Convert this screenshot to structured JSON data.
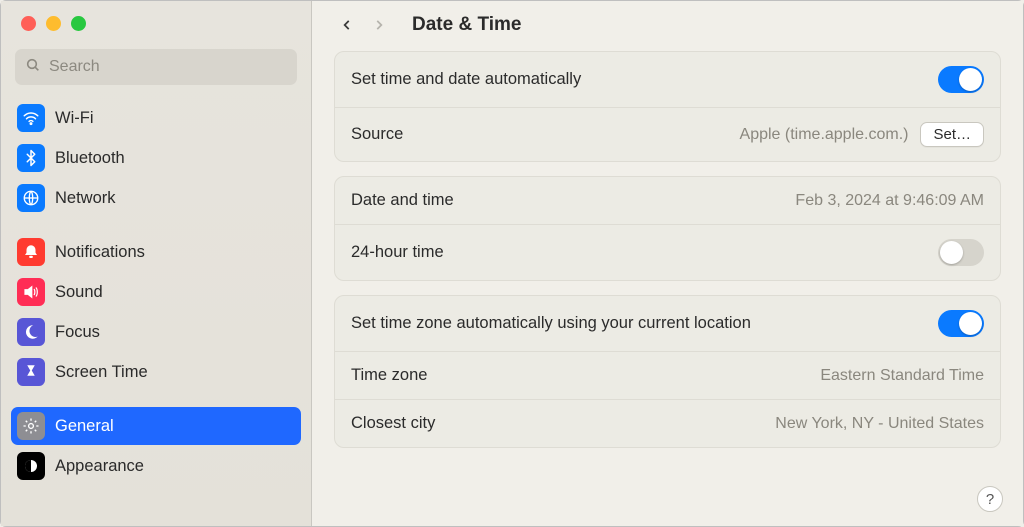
{
  "window": {
    "title": "Date & Time"
  },
  "search": {
    "placeholder": "Search"
  },
  "sidebar": {
    "items": [
      {
        "label": "Wi-Fi",
        "icon": "wifi-icon",
        "selected": false,
        "color": "bg-blue"
      },
      {
        "label": "Bluetooth",
        "icon": "bluetooth-icon",
        "selected": false,
        "color": "bg-blue"
      },
      {
        "label": "Network",
        "icon": "network-icon",
        "selected": false,
        "color": "bg-globe"
      },
      {
        "label": "Notifications",
        "icon": "notifications-icon",
        "selected": false,
        "color": "bg-red"
      },
      {
        "label": "Sound",
        "icon": "sound-icon",
        "selected": false,
        "color": "bg-pink"
      },
      {
        "label": "Focus",
        "icon": "focus-icon",
        "selected": false,
        "color": "bg-indigo"
      },
      {
        "label": "Screen Time",
        "icon": "screentime-icon",
        "selected": false,
        "color": "bg-indigo"
      },
      {
        "label": "General",
        "icon": "general-icon",
        "selected": true,
        "color": "bg-gray"
      },
      {
        "label": "Appearance",
        "icon": "appearance-icon",
        "selected": false,
        "color": "bg-black"
      }
    ]
  },
  "main": {
    "autoTime": {
      "label": "Set time and date automatically",
      "on": true
    },
    "source": {
      "label": "Source",
      "value": "Apple (time.apple.com.)",
      "button": "Set…"
    },
    "dateTime": {
      "label": "Date and time",
      "value": "Feb 3, 2024 at 9:46:09 AM"
    },
    "twentyFourHour": {
      "label": "24-hour time",
      "on": false
    },
    "autoTZ": {
      "label": "Set time zone automatically using your current location",
      "on": true
    },
    "timeZone": {
      "label": "Time zone",
      "value": "Eastern Standard Time"
    },
    "closestCity": {
      "label": "Closest city",
      "value": "New York, NY - United States"
    }
  },
  "help": "?"
}
